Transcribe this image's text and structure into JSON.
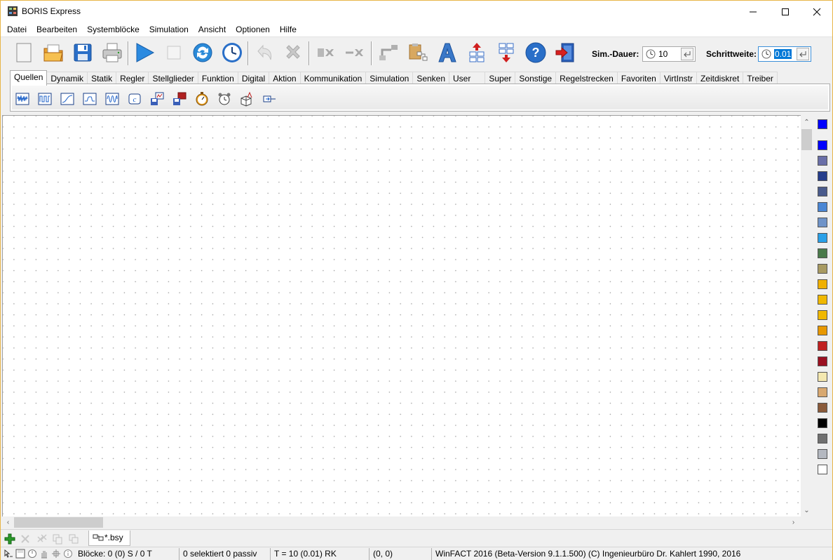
{
  "window": {
    "title": "BORIS Express"
  },
  "menu": [
    "Datei",
    "Bearbeiten",
    "Systemblöcke",
    "Simulation",
    "Ansicht",
    "Optionen",
    "Hilfe"
  ],
  "toolbar": {
    "sim_duration_label": "Sim.-Dauer:",
    "sim_duration_value": "10",
    "step_label": "Schrittweite:",
    "step_value": "0.01"
  },
  "palette_tabs": [
    "Quellen",
    "Dynamik",
    "Statik",
    "Regler",
    "Stellglieder",
    "Funktion",
    "Digital",
    "Aktion",
    "Kommunikation",
    "Simulation",
    "Senken",
    "User",
    "Super",
    "Sonstige",
    "Regelstrecken",
    "Favoriten",
    "VirtInstr",
    "Zeitdiskret",
    "Treiber"
  ],
  "active_tab": "Quellen",
  "document_tab": "*.bsy",
  "status": {
    "blocks": "Blöcke: 0 (0) S / 0 T",
    "selection": "0 selektiert  0 passiv",
    "time": "T = 10  (0.01)  RK",
    "coords": "(0, 0)",
    "version": "WinFACT 2016 (Beta-Version 9.1.1.500)  (C) Ingenieurbüro Dr. Kahlert 1990, 2016"
  },
  "colors": {
    "active_color": "#0000ff",
    "swatches": [
      "#0000ff",
      "#6a6fa8",
      "#253d8c",
      "#4a5b8c",
      "#4a86d4",
      "#6f93c8",
      "#2aa0e8",
      "#4a7a4a",
      "#a89a62",
      "#f0b000",
      "#f0b800",
      "#f0b800",
      "#e89800",
      "#c02020",
      "#9a1020",
      "#f4e8b0",
      "#d8a870",
      "#8a5a3a",
      "#000000",
      "#707070",
      "#b4b8c0",
      "#ffffff"
    ]
  }
}
